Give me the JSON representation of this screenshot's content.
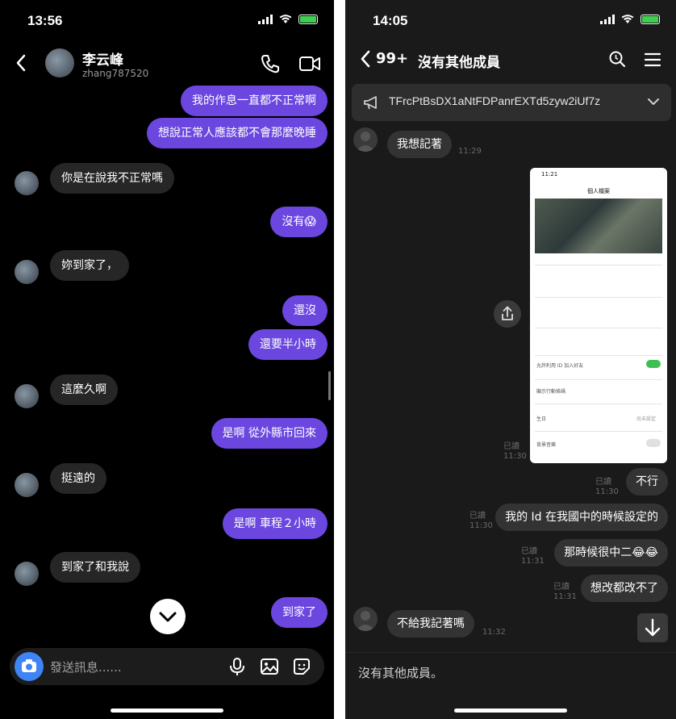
{
  "left_phone": {
    "status_time": "13:56",
    "contact_name": "李云峰",
    "contact_username": "zhang787520",
    "messages": [
      {
        "side": "out",
        "text": "我的作息一直都不正常啊"
      },
      {
        "side": "out",
        "text": "想說正常人應該都不會那麼晚睡"
      },
      {
        "side": "in",
        "text": "你是在說我不正常嗎"
      },
      {
        "side": "out",
        "text": "沒有😱"
      },
      {
        "side": "in",
        "text": "妳到家了，"
      },
      {
        "side": "out",
        "text": "還沒"
      },
      {
        "side": "out",
        "text": "還要半小時"
      },
      {
        "side": "in",
        "text": "這麼久啊"
      },
      {
        "side": "out",
        "text": "是啊 從外縣市回來"
      },
      {
        "side": "in",
        "text": "挺遠的"
      },
      {
        "side": "out",
        "text": "是啊 車程２小時"
      },
      {
        "side": "in",
        "text": "到家了和我說"
      },
      {
        "side": "out",
        "text": "到家了"
      }
    ],
    "composer_placeholder": "發送訊息......",
    "accent_color": "#6b47e0"
  },
  "right_phone": {
    "status_time": "14:05",
    "unread_count": "99+",
    "chat_title": "沒有其他成員",
    "announcement": "TFrcPtBsDX1aNtFDPanrEXTd5zyw2iUf7z",
    "messages": [
      {
        "side": "in",
        "text": "我想記著",
        "time": "11:29"
      },
      {
        "side": "out",
        "text": "不行",
        "read": "已讀",
        "time": "11:30"
      },
      {
        "side": "out",
        "text": "我的 Id 在我國中的時候設定的",
        "read": "已讀",
        "time": "11:30"
      },
      {
        "side": "out",
        "text": "那時候很中二😂😂",
        "read": "已讀",
        "time": "11:31"
      },
      {
        "side": "out",
        "text": "想改都改不了",
        "read": "已讀",
        "time": "11:31"
      },
      {
        "side": "in",
        "text": "不給我記著嗎",
        "time": "11:32"
      }
    ],
    "image_message": {
      "read": "已讀",
      "time": "11:30"
    },
    "screenshot": {
      "time": "11:21",
      "title": "個人檔案",
      "rows": [
        "允許利用 ID 加入好友",
        "顯示行動條碼",
        "生日",
        "背景音樂"
      ],
      "birthday_value": "尚未設定"
    },
    "footer_text": "沒有其他成員。"
  }
}
